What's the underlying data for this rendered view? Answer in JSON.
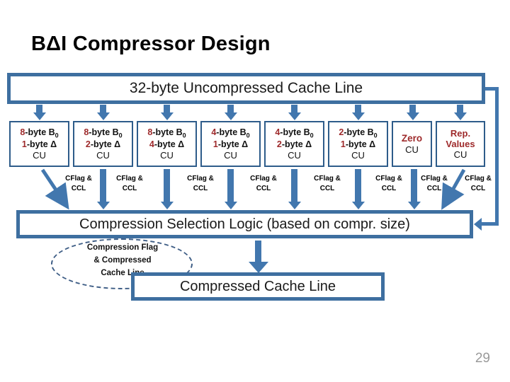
{
  "slide": {
    "title": "BΔI Compressor Design",
    "page_number": "29",
    "accent_blue": "#3E6FA0",
    "arrow_blue": "#4277AE",
    "accent_red": "#9E2A2B"
  },
  "top_bar": {
    "label": "32-byte Uncompressed Cache Line"
  },
  "compression_units": [
    {
      "base": "8-byte B",
      "base_sub": "0",
      "delta": "1-byte Δ",
      "cu": "CU",
      "base_num": "8",
      "delta_num": "1",
      "style": "delta"
    },
    {
      "base": "8-byte B",
      "base_sub": "0",
      "delta": "2-byte Δ",
      "cu": "CU",
      "base_num": "8",
      "delta_num": "2",
      "style": "delta"
    },
    {
      "base": "8-byte B",
      "base_sub": "0",
      "delta": "4-byte Δ",
      "cu": "CU",
      "base_num": "8",
      "delta_num": "4",
      "style": "delta"
    },
    {
      "base": "4-byte B",
      "base_sub": "0",
      "delta": "1-byte Δ",
      "cu": "CU",
      "base_num": "4",
      "delta_num": "1",
      "style": "delta"
    },
    {
      "base": "4-byte B",
      "base_sub": "0",
      "delta": "2-byte Δ",
      "cu": "CU",
      "base_num": "4",
      "delta_num": "2",
      "style": "delta"
    },
    {
      "base": "2-byte B",
      "base_sub": "0",
      "delta": "1-byte Δ",
      "cu": "CU",
      "base_num": "2",
      "delta_num": "1",
      "style": "delta"
    },
    {
      "title": "Zero",
      "cu": "CU",
      "style": "special"
    },
    {
      "title_line1": "Rep.",
      "title_line2": "Values",
      "cu": "CU",
      "style": "special2"
    }
  ],
  "cflag_labels": [
    "CFlag & CCL",
    "CFlag & CCL",
    "CFlag & CCL",
    "CFlag & CCL",
    "CFlag & CCL",
    "CFlag & CCL",
    "CFlag & CCL",
    "CFlag & CCL"
  ],
  "cflag_label_line1": "CFlag &",
  "cflag_label_line2": "CCL",
  "selection_logic": {
    "label": "Compression Selection Logic (based on compr. size)"
  },
  "output": {
    "label": "Compressed Cache Line"
  },
  "annotation_ellipse": {
    "line1": "Compression Flag",
    "line2": "& Compressed",
    "line3": "Cache Line"
  }
}
